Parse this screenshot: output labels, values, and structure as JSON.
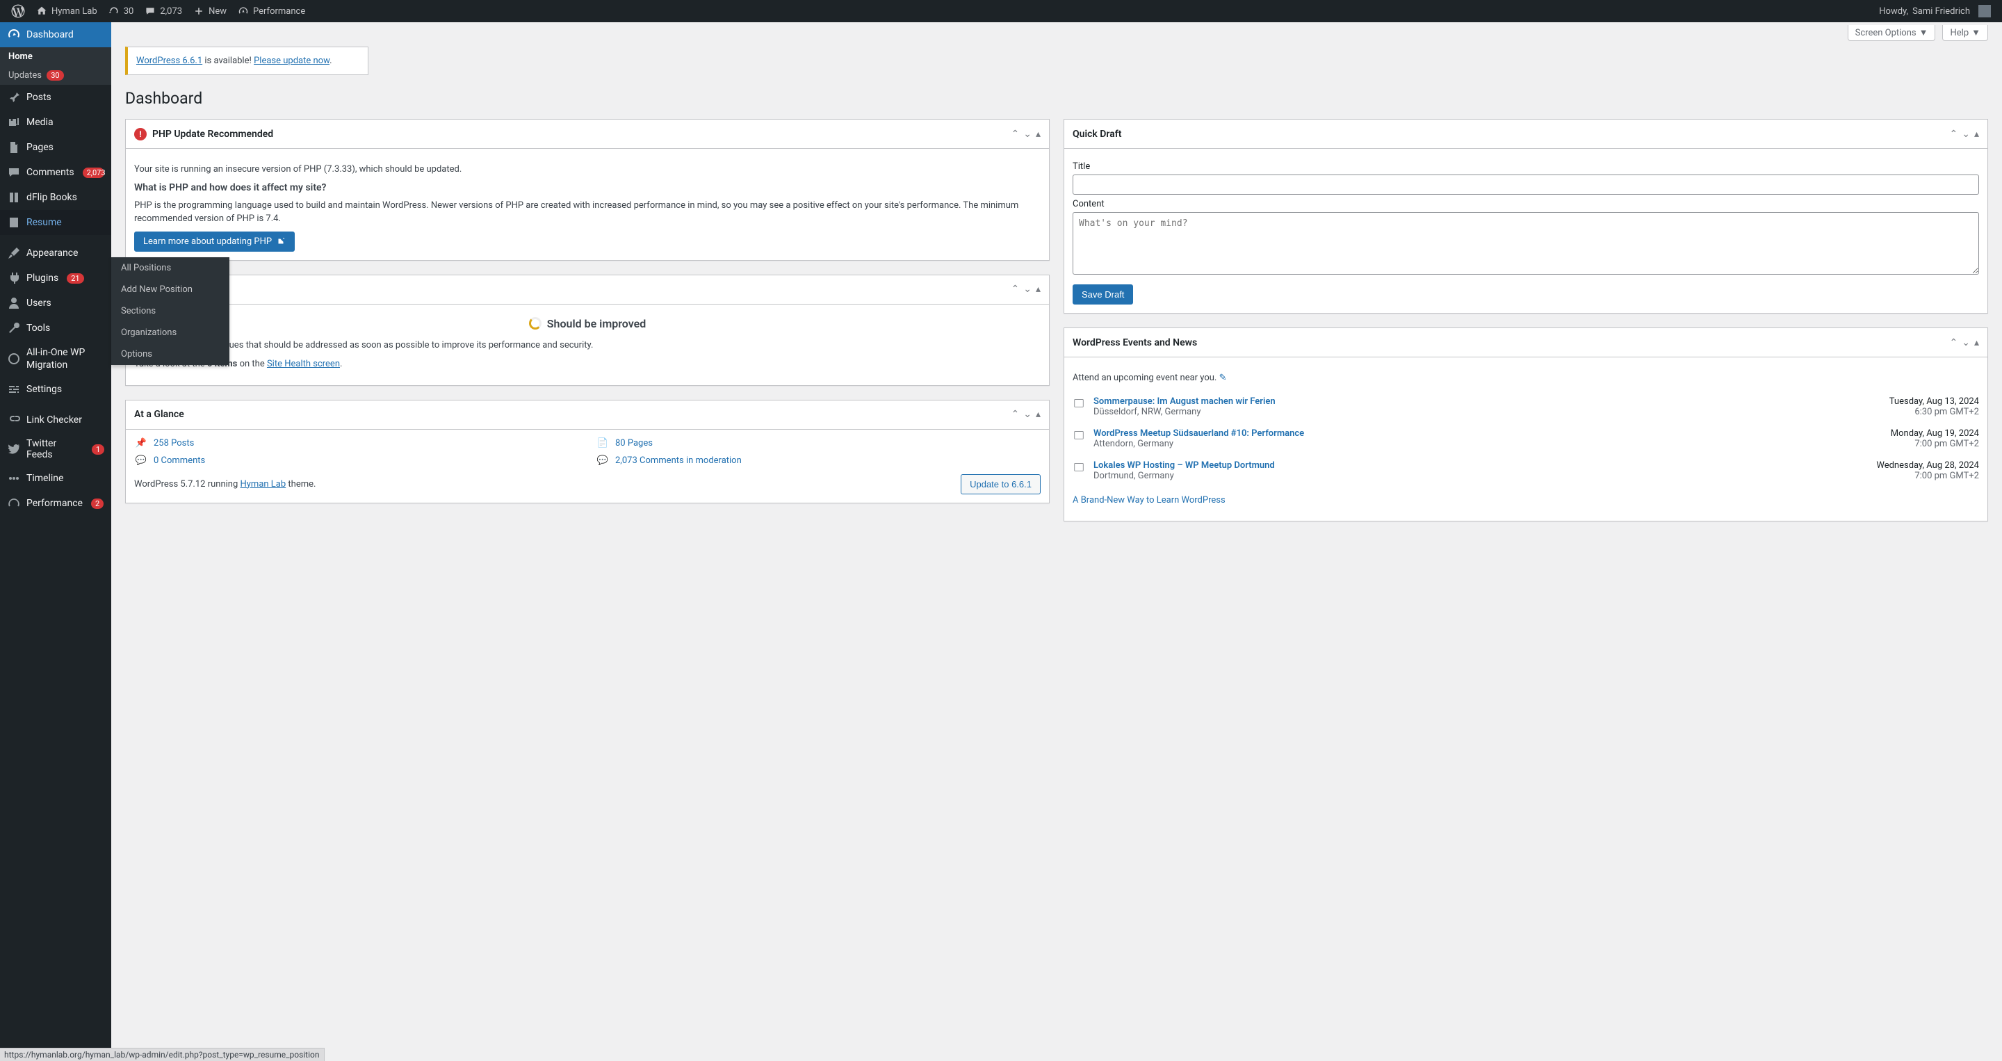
{
  "topbar": {
    "site_name": "Hyman Lab",
    "updates_count": "30",
    "comments_count": "2,073",
    "new_label": "New",
    "performance_label": "Performance",
    "howdy_prefix": "Howdy, ",
    "user_name": "Sami Friedrich"
  },
  "screen_meta": {
    "screen_options": "Screen Options",
    "help": "Help"
  },
  "update_notice": {
    "version_link": "WordPress 6.6.1",
    "available_text": " is available! ",
    "update_link": "Please update now",
    "period": "."
  },
  "page_title": "Dashboard",
  "sidebar": {
    "dashboard": "Dashboard",
    "home": "Home",
    "updates": "Updates",
    "updates_badge": "30",
    "posts": "Posts",
    "media": "Media",
    "pages": "Pages",
    "comments": "Comments",
    "comments_badge": "2,073",
    "dflip": "dFlip Books",
    "resume": "Resume",
    "appearance": "Appearance",
    "plugins": "Plugins",
    "plugins_badge": "21",
    "users": "Users",
    "tools": "Tools",
    "migration": "All-in-One WP Migration",
    "settings": "Settings",
    "linkchecker": "Link Checker",
    "twitter": "Twitter Feeds",
    "twitter_badge": "1",
    "timeline": "Timeline",
    "performance": "Performance",
    "performance_badge": "2"
  },
  "resume_flyout": {
    "all_positions": "All Positions",
    "add_new": "Add New Position",
    "sections": "Sections",
    "organizations": "Organizations",
    "options": "Options"
  },
  "php_box": {
    "title": "PHP Update Recommended",
    "line1": "Your site is running an insecure version of PHP (7.3.33), which should be updated.",
    "heading": "What is PHP and how does it affect my site?",
    "line2": "PHP is the programming language used to build and maintain WordPress. Newer versions of PHP are created with increased performance in mind, so you may see a positive effect on your site's performance. The minimum recommended version of PHP is 7.4.",
    "button": "Learn more about updating PHP"
  },
  "health_box": {
    "status_label": "Should be improved",
    "line1": "Your site has critical issues that should be addressed as soon as possible to improve its performance and security.",
    "line2_a": "Take a look at the ",
    "line2_b": "6 items",
    "line2_c": " on the ",
    "link": "Site Health screen",
    "period": "."
  },
  "glance_box": {
    "title": "At a Glance",
    "posts": "258 Posts",
    "pages": "80 Pages",
    "comments": "0 Comments",
    "moderation": "2,073 Comments in moderation",
    "wp_a": "WordPress 5.7.12 running ",
    "wp_link": "Hyman Lab",
    "wp_b": " theme.",
    "update_btn": "Update to 6.6.1"
  },
  "quickdraft": {
    "title": "Quick Draft",
    "title_label": "Title",
    "content_label": "Content",
    "content_placeholder": "What's on your mind?",
    "save_btn": "Save Draft"
  },
  "events_box": {
    "title": "WordPress Events and News",
    "attend_text": "Attend an upcoming event near you. ",
    "footer_link": "A Brand-New Way to Learn WordPress",
    "events": [
      {
        "title": "Sommerpause: Im August machen wir Ferien",
        "loc": "Düsseldorf, NRW, Germany",
        "date": "Tuesday, Aug 13, 2024",
        "time": "6:30 pm GMT+2"
      },
      {
        "title": "WordPress Meetup Südsauerland #10: Performance",
        "loc": "Attendorn, Germany",
        "date": "Monday, Aug 19, 2024",
        "time": "7:00 pm GMT+2"
      },
      {
        "title": "Lokales WP Hosting – WP Meetup Dortmund",
        "loc": "Dortmund, Germany",
        "date": "Wednesday, Aug 28, 2024",
        "time": "7:00 pm GMT+2"
      }
    ]
  },
  "status_url": "https://hymanlab.org/hyman_lab/wp-admin/edit.php?post_type=wp_resume_position"
}
